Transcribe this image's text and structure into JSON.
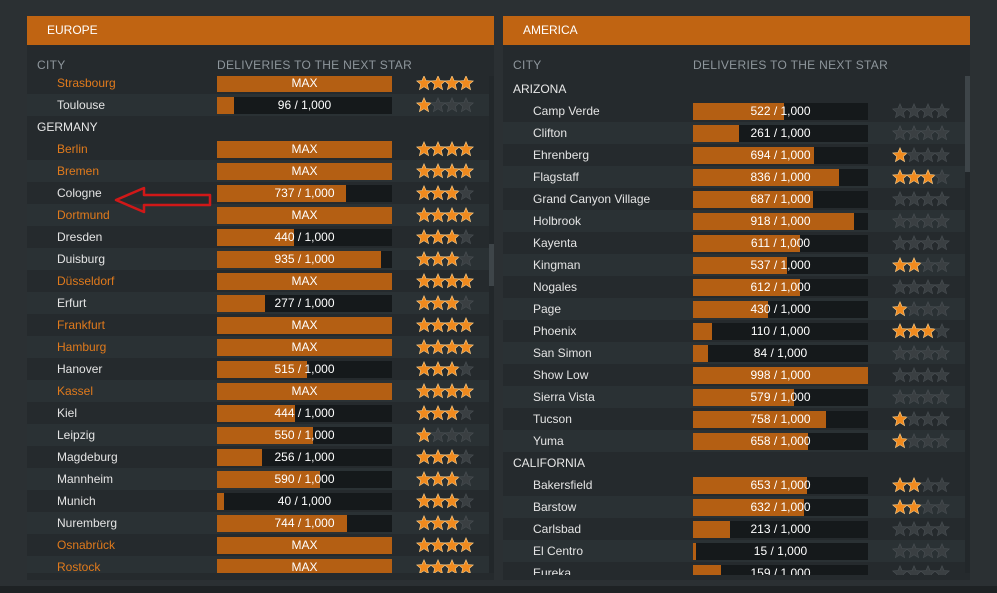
{
  "colors": {
    "accent": "#c06412",
    "bar_fill": "#b45f13",
    "bar_empty": "#15191b",
    "city_max": "#e07a1c",
    "star_on": "#f08a1e",
    "star_off": "#3a3f42",
    "arrow": "#d01818"
  },
  "europe": {
    "title": "EUROPE",
    "col_city": "CITY",
    "col_deliveries": "DELIVERIES TO THE NEXT STAR",
    "rows": [
      {
        "type": "city",
        "name": "Strasbourg",
        "text": "MAX",
        "fill": 1,
        "stars": 4,
        "max": true
      },
      {
        "type": "city",
        "name": "Toulouse",
        "text": "96 / 1,000",
        "fill": 0.096,
        "stars": 1,
        "max": false
      },
      {
        "type": "region",
        "name": "GERMANY"
      },
      {
        "type": "city",
        "name": "Berlin",
        "text": "MAX",
        "fill": 1,
        "stars": 4,
        "max": true
      },
      {
        "type": "city",
        "name": "Bremen",
        "text": "MAX",
        "fill": 1,
        "stars": 4,
        "max": true
      },
      {
        "type": "city",
        "name": "Cologne",
        "text": "737 / 1,000",
        "fill": 0.737,
        "stars": 3,
        "max": false
      },
      {
        "type": "city",
        "name": "Dortmund",
        "text": "MAX",
        "fill": 1,
        "stars": 4,
        "max": true
      },
      {
        "type": "city",
        "name": "Dresden",
        "text": "440 / 1,000",
        "fill": 0.44,
        "stars": 3,
        "max": false
      },
      {
        "type": "city",
        "name": "Duisburg",
        "text": "935 / 1,000",
        "fill": 0.935,
        "stars": 3,
        "max": false
      },
      {
        "type": "city",
        "name": "Düsseldorf",
        "text": "MAX",
        "fill": 1,
        "stars": 4,
        "max": true
      },
      {
        "type": "city",
        "name": "Erfurt",
        "text": "277 / 1,000",
        "fill": 0.277,
        "stars": 3,
        "max": false
      },
      {
        "type": "city",
        "name": "Frankfurt",
        "text": "MAX",
        "fill": 1,
        "stars": 4,
        "max": true
      },
      {
        "type": "city",
        "name": "Hamburg",
        "text": "MAX",
        "fill": 1,
        "stars": 4,
        "max": true
      },
      {
        "type": "city",
        "name": "Hanover",
        "text": "515 / 1,000",
        "fill": 0.515,
        "stars": 3,
        "max": false
      },
      {
        "type": "city",
        "name": "Kassel",
        "text": "MAX",
        "fill": 1,
        "stars": 4,
        "max": true
      },
      {
        "type": "city",
        "name": "Kiel",
        "text": "444 / 1,000",
        "fill": 0.444,
        "stars": 3,
        "max": false
      },
      {
        "type": "city",
        "name": "Leipzig",
        "text": "550 / 1,000",
        "fill": 0.55,
        "stars": 1,
        "max": false
      },
      {
        "type": "city",
        "name": "Magdeburg",
        "text": "256 / 1,000",
        "fill": 0.256,
        "stars": 3,
        "max": false
      },
      {
        "type": "city",
        "name": "Mannheim",
        "text": "590 / 1,000",
        "fill": 0.59,
        "stars": 3,
        "max": false
      },
      {
        "type": "city",
        "name": "Munich",
        "text": "40 / 1,000",
        "fill": 0.04,
        "stars": 3,
        "max": false
      },
      {
        "type": "city",
        "name": "Nuremberg",
        "text": "744 / 1,000",
        "fill": 0.744,
        "stars": 3,
        "max": false
      },
      {
        "type": "city",
        "name": "Osnabrück",
        "text": "MAX",
        "fill": 1,
        "stars": 4,
        "max": true
      },
      {
        "type": "city",
        "name": "Rostock",
        "text": "MAX",
        "fill": 1,
        "stars": 4,
        "max": true
      }
    ]
  },
  "america": {
    "title": "AMERICA",
    "col_city": "CITY",
    "col_deliveries": "DELIVERIES TO THE NEXT STAR",
    "rows": [
      {
        "type": "region",
        "name": "ARIZONA"
      },
      {
        "type": "city",
        "name": "Camp Verde",
        "text": "522 / 1,000",
        "fill": 0.522,
        "stars": 0,
        "max": false
      },
      {
        "type": "city",
        "name": "Clifton",
        "text": "261 / 1,000",
        "fill": 0.261,
        "stars": 0,
        "max": false
      },
      {
        "type": "city",
        "name": "Ehrenberg",
        "text": "694 / 1,000",
        "fill": 0.694,
        "stars": 1,
        "max": false
      },
      {
        "type": "city",
        "name": "Flagstaff",
        "text": "836 / 1,000",
        "fill": 0.836,
        "stars": 3,
        "max": false
      },
      {
        "type": "city",
        "name": "Grand Canyon Village",
        "text": "687 / 1,000",
        "fill": 0.687,
        "stars": 0,
        "max": false
      },
      {
        "type": "city",
        "name": "Holbrook",
        "text": "918 / 1,000",
        "fill": 0.918,
        "stars": 0,
        "max": false
      },
      {
        "type": "city",
        "name": "Kayenta",
        "text": "611 / 1,000",
        "fill": 0.611,
        "stars": 0,
        "max": false
      },
      {
        "type": "city",
        "name": "Kingman",
        "text": "537 / 1,000",
        "fill": 0.537,
        "stars": 2,
        "max": false
      },
      {
        "type": "city",
        "name": "Nogales",
        "text": "612 / 1,000",
        "fill": 0.612,
        "stars": 0,
        "max": false
      },
      {
        "type": "city",
        "name": "Page",
        "text": "430 / 1,000",
        "fill": 0.43,
        "stars": 1,
        "max": false
      },
      {
        "type": "city",
        "name": "Phoenix",
        "text": "110 / 1,000",
        "fill": 0.11,
        "stars": 3,
        "max": false
      },
      {
        "type": "city",
        "name": "San Simon",
        "text": "84 / 1,000",
        "fill": 0.084,
        "stars": 0,
        "max": false
      },
      {
        "type": "city",
        "name": "Show Low",
        "text": "998 / 1,000",
        "fill": 0.998,
        "stars": 0,
        "max": false
      },
      {
        "type": "city",
        "name": "Sierra Vista",
        "text": "579 / 1,000",
        "fill": 0.579,
        "stars": 0,
        "max": false
      },
      {
        "type": "city",
        "name": "Tucson",
        "text": "758 / 1,000",
        "fill": 0.758,
        "stars": 1,
        "max": false
      },
      {
        "type": "city",
        "name": "Yuma",
        "text": "658 / 1,000",
        "fill": 0.658,
        "stars": 1,
        "max": false
      },
      {
        "type": "region",
        "name": "CALIFORNIA"
      },
      {
        "type": "city",
        "name": "Bakersfield",
        "text": "653 / 1,000",
        "fill": 0.653,
        "stars": 2,
        "max": false
      },
      {
        "type": "city",
        "name": "Barstow",
        "text": "632 / 1,000",
        "fill": 0.632,
        "stars": 2,
        "max": false
      },
      {
        "type": "city",
        "name": "Carlsbad",
        "text": "213 / 1,000",
        "fill": 0.213,
        "stars": 0,
        "max": false
      },
      {
        "type": "city",
        "name": "El Centro",
        "text": "15 / 1,000",
        "fill": 0.015,
        "stars": 0,
        "max": false
      },
      {
        "type": "city",
        "name": "Eureka",
        "text": "159 / 1,000",
        "fill": 0.159,
        "stars": 0,
        "max": false
      }
    ]
  }
}
